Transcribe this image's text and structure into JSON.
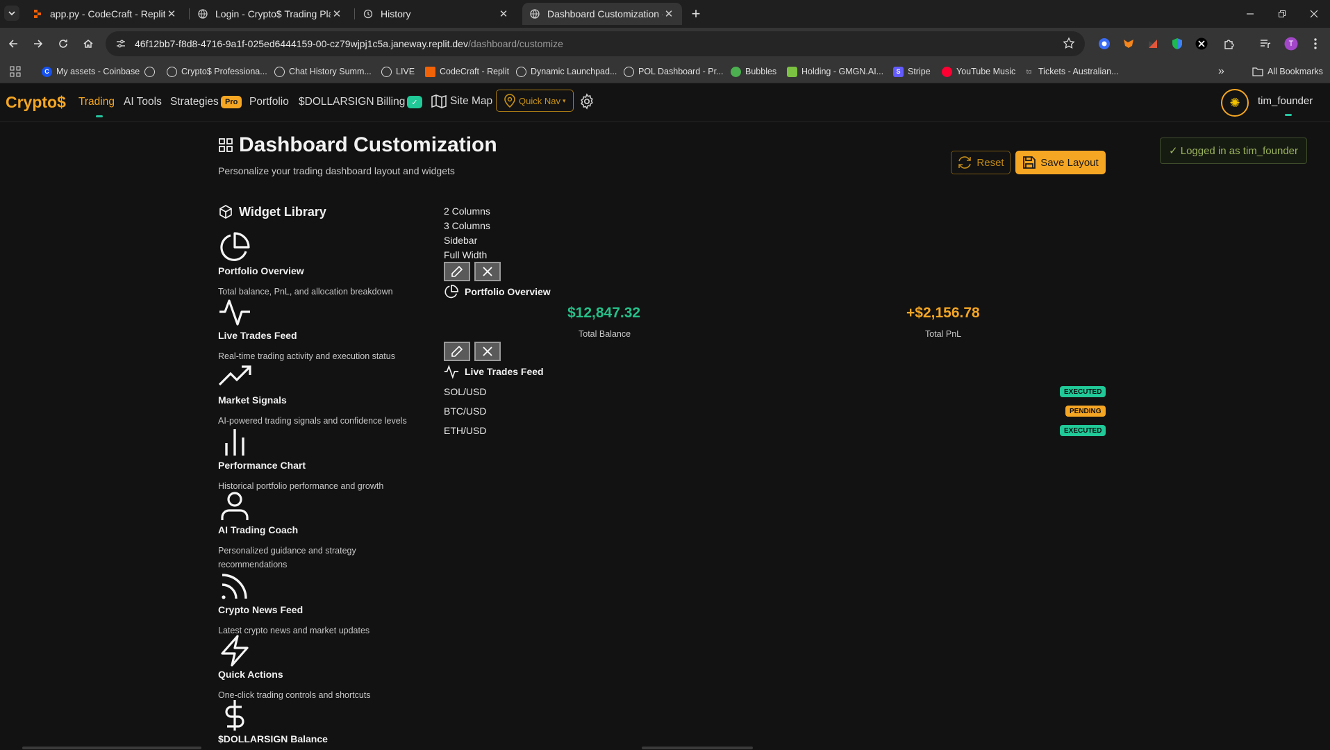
{
  "browser": {
    "tabs": [
      {
        "title": "app.py - CodeCraft - Replit"
      },
      {
        "title": "Login - Crypto$ Trading Platform"
      },
      {
        "title": "History"
      },
      {
        "title": "Dashboard Customization - Crypto$"
      }
    ],
    "url_host": "46f12bb7-f8d8-4716-9a1f-025ed6444159-00-cz79wjpj1c5a.janeway.replit.dev",
    "url_path": "/dashboard/customize",
    "bookmarks": [
      {
        "label": "My assets - Coinbase",
        "color": "#1652f0"
      },
      {
        "label": "",
        "color": "#dddddd"
      },
      {
        "label": "Crypto$ Professiona...",
        "color": "#dddddd"
      },
      {
        "label": "Chat History Summ...",
        "color": "#dddddd"
      },
      {
        "label": "LIVE",
        "color": "#dddddd"
      },
      {
        "label": "CodeCraft - Replit",
        "color": "#f26207"
      },
      {
        "label": "Dynamic Launchpad...",
        "color": "#dddddd"
      },
      {
        "label": "POL Dashboard - Pr...",
        "color": "#dddddd"
      },
      {
        "label": "Bubbles",
        "color": "#4caf50"
      },
      {
        "label": "Holding - GMGN.AI...",
        "color": "#7cc242"
      },
      {
        "label": "Stripe",
        "color": "#635bff"
      },
      {
        "label": "YouTube Music",
        "color": "#ff0033"
      },
      {
        "label": "Tickets - Australian...",
        "color": "#888888"
      }
    ],
    "all_bookmarks": "All Bookmarks",
    "profile_initial": "T"
  },
  "nav": {
    "brand": "Crypto$",
    "items": [
      "Trading",
      "AI Tools",
      "Strategies",
      "Portfolio",
      "$DOLLARSIGN",
      "Billing"
    ],
    "pro_badge": "Pro",
    "billing_badge": "✓",
    "site_map": "Site Map",
    "quick_nav": "Quick Nav",
    "username": "tim_founder"
  },
  "page": {
    "title": "Dashboard Customization",
    "subtitle": "Personalize your trading dashboard layout and widgets",
    "reset_label": "Reset",
    "save_label": "Save Layout",
    "logged_in": "✓ Logged in as tim_founder"
  },
  "library": {
    "title": "Widget Library",
    "widgets": [
      {
        "name": "Portfolio Overview",
        "desc": "Total balance, PnL, and allocation breakdown",
        "icon": "pie-chart-icon"
      },
      {
        "name": "Live Trades Feed",
        "desc": "Real-time trading activity and execution status",
        "icon": "activity-icon"
      },
      {
        "name": "Market Signals",
        "desc": "AI-powered trading signals and confidence levels",
        "icon": "trending-up-icon"
      },
      {
        "name": "Performance Chart",
        "desc": "Historical portfolio performance and growth",
        "icon": "bar-chart-icon"
      },
      {
        "name": "AI Trading Coach",
        "desc": "Personalized guidance and strategy recommendations",
        "icon": "user-icon"
      },
      {
        "name": "Crypto News Feed",
        "desc": "Latest crypto news and market updates",
        "icon": "rss-icon"
      },
      {
        "name": "Quick Actions",
        "desc": "One-click trading controls and shortcuts",
        "icon": "zap-icon"
      },
      {
        "name": "$DOLLARSIGN Balance",
        "desc": "",
        "icon": "dollar-icon"
      }
    ]
  },
  "layout_options": [
    "2 Columns",
    "3 Columns",
    "Sidebar",
    "Full Width"
  ],
  "canvas": {
    "portfolio": {
      "title": "Portfolio Overview",
      "total_balance": "$12,847.32",
      "total_balance_label": "Total Balance",
      "total_pnl": "+$2,156.78",
      "total_pnl_label": "Total PnL"
    },
    "trades": {
      "title": "Live Trades Feed",
      "rows": [
        {
          "pair": "SOL/USD",
          "status": "EXECUTED"
        },
        {
          "pair": "BTC/USD",
          "status": "PENDING"
        },
        {
          "pair": "ETH/USD",
          "status": "EXECUTED"
        }
      ]
    }
  },
  "colors": {
    "accent": "#f5a623",
    "positive": "#26c08a",
    "executed": "#20c997",
    "pending": "#f5a623"
  }
}
